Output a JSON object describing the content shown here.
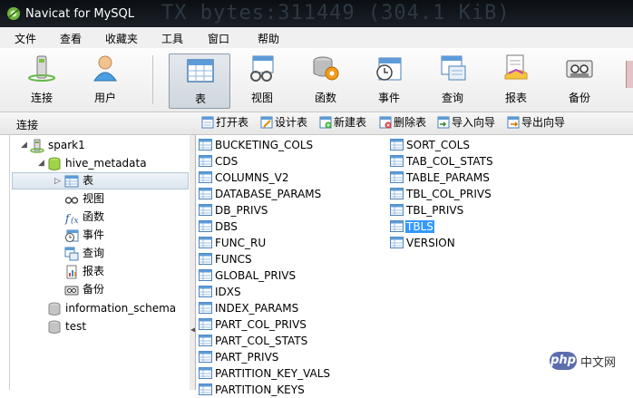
{
  "window": {
    "title": "Navicat for MySQL",
    "background_text": "TX bytes:311449 (304.1 KiB)"
  },
  "menu": [
    "文件",
    "查看",
    "收藏夹",
    "工具",
    "窗口",
    "帮助"
  ],
  "toolbar": [
    {
      "label": "连接",
      "icon": "connection-icon"
    },
    {
      "label": "用户",
      "icon": "user-icon"
    },
    {
      "label": "表",
      "icon": "table-icon",
      "active": true
    },
    {
      "label": "视图",
      "icon": "view-icon"
    },
    {
      "label": "函数",
      "icon": "function-icon"
    },
    {
      "label": "事件",
      "icon": "event-icon"
    },
    {
      "label": "查询",
      "icon": "query-icon"
    },
    {
      "label": "报表",
      "icon": "report-icon"
    },
    {
      "label": "备份",
      "icon": "backup-icon"
    }
  ],
  "subbar": {
    "connection_label": "连接",
    "actions": [
      "打开表",
      "设计表",
      "新建表",
      "删除表",
      "导入向导",
      "导出向导"
    ]
  },
  "tree": {
    "connection": "spark1",
    "database": "hive_metadata",
    "children": [
      "表",
      "视图",
      "函数",
      "事件",
      "查询",
      "报表",
      "备份"
    ],
    "other_databases": [
      "information_schema",
      "test"
    ]
  },
  "tables_col1": [
    "BUCKETING_COLS",
    "CDS",
    "COLUMNS_V2",
    "DATABASE_PARAMS",
    "DB_PRIVS",
    "DBS",
    "FUNC_RU",
    "FUNCS",
    "GLOBAL_PRIVS",
    "IDXS",
    "INDEX_PARAMS",
    "PART_COL_PRIVS",
    "PART_COL_STATS",
    "PART_PRIVS",
    "PARTITION_KEY_VALS",
    "PARTITION_KEYS"
  ],
  "tables_col2": [
    "SORT_COLS",
    "TAB_COL_STATS",
    "TABLE_PARAMS",
    "TBL_COL_PRIVS",
    "TBL_PRIVS",
    "TBLS",
    "VERSION"
  ],
  "selected_table": "TBLS",
  "watermark": {
    "badge": "php",
    "text": "中文网"
  },
  "colors": {
    "selection": "#3399ff",
    "titlebar": "#0b0f14"
  }
}
